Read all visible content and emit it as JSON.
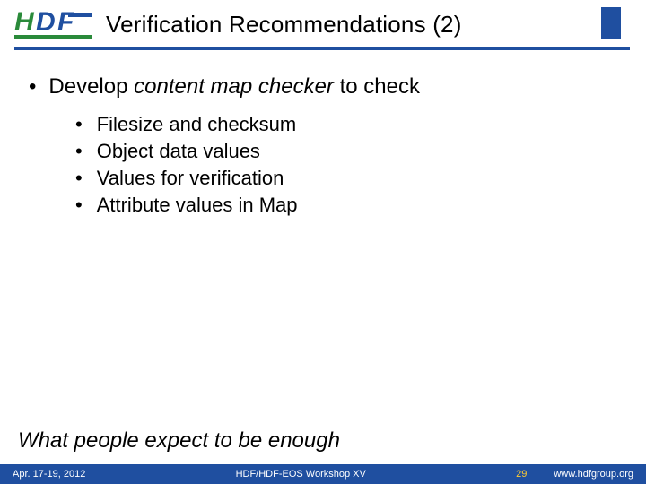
{
  "header": {
    "title": "Verification Recommendations (2)"
  },
  "body": {
    "lead_pre": "Develop ",
    "lead_emph": "content map checker",
    "lead_post": " to check",
    "items": [
      "Filesize and checksum",
      "Object data values",
      "Values for verification",
      "Attribute values in Map"
    ]
  },
  "closing": "What people expect to be enough",
  "footer": {
    "date": "Apr. 17-19, 2012",
    "center": "HDF/HDF-EOS Workshop XV",
    "page": "29",
    "url": "www.hdfgroup.org"
  },
  "colors": {
    "brand_blue": "#1f4fa0",
    "brand_green": "#2a8a3a",
    "accent_yellow": "#ffcc33"
  }
}
